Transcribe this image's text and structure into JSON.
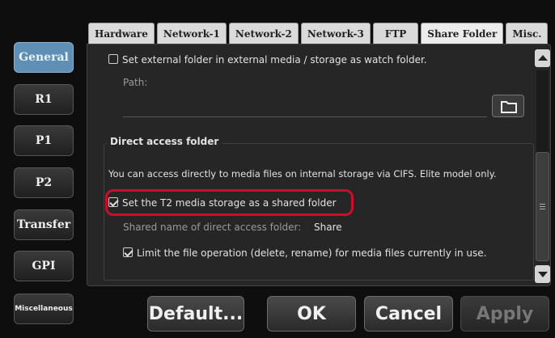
{
  "nav": {
    "items": [
      {
        "label": "General",
        "active": true
      },
      {
        "label": "R1"
      },
      {
        "label": "P1"
      },
      {
        "label": "P2"
      },
      {
        "label": "Transfer"
      },
      {
        "label": "GPI"
      },
      {
        "label": "Miscellaneous"
      }
    ]
  },
  "tabs": [
    {
      "label": "Hardware"
    },
    {
      "label": "Network-1"
    },
    {
      "label": "Network-2"
    },
    {
      "label": "Network-3"
    },
    {
      "label": "FTP"
    },
    {
      "label": "Share Folder",
      "active": true
    },
    {
      "label": "Misc."
    }
  ],
  "watch_folder": {
    "checkbox_label": "Set external folder in external media / storage as watch folder.",
    "checked": false,
    "path_label": "Path:",
    "path_value": ""
  },
  "direct_access": {
    "title": "Direct access folder",
    "description": "You can access directly to media files on internal storage via CIFS. Elite model only.",
    "share_checkbox_label": "Set the T2 media storage as a shared folder",
    "share_checked": true,
    "shared_name_label": "Shared name of direct access folder:",
    "shared_name_value": "Share",
    "limit_checkbox_label": "Limit the file operation (delete, rename) for media files currently in use.",
    "limit_checked": true
  },
  "actions": {
    "default_label": "Default...",
    "ok_label": "OK",
    "cancel_label": "Cancel",
    "apply_label": "Apply"
  },
  "colors": {
    "active_nav": "#5f8fb4",
    "highlight": "#c8102e"
  }
}
